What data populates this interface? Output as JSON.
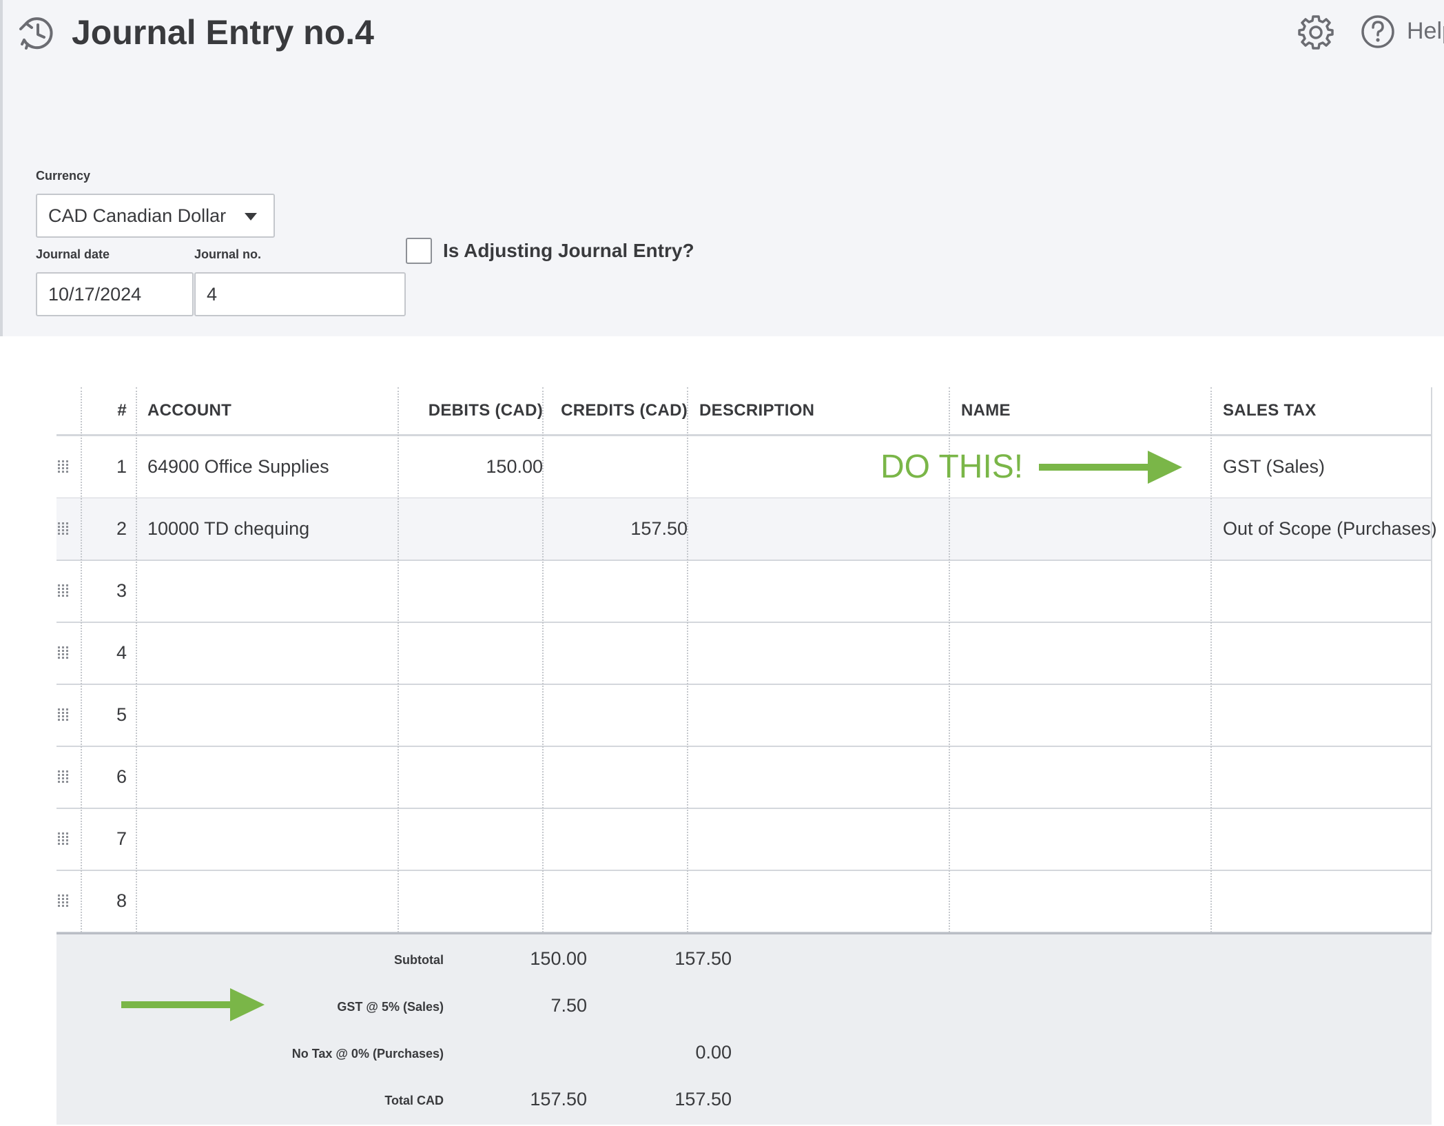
{
  "header": {
    "title": "Journal Entry no.4",
    "help_label": "Help"
  },
  "form": {
    "currency_label": "Currency",
    "currency_value": "CAD Canadian Dollar",
    "journal_date_label": "Journal date",
    "journal_date_value": "10/17/2024",
    "journal_no_label": "Journal no.",
    "journal_no_value": "4",
    "adjusting_label": "Is Adjusting Journal Entry?",
    "adjusting_checked": false
  },
  "table": {
    "columns": [
      "#",
      "ACCOUNT",
      "DEBITS (CAD)",
      "CREDITS (CAD)",
      "DESCRIPTION",
      "NAME",
      "SALES TAX"
    ],
    "rows": [
      {
        "num": "1",
        "account": "64900 Office Supplies",
        "debit": "150.00",
        "credit": "",
        "description": "",
        "name": "",
        "sales_tax": "GST (Sales)"
      },
      {
        "num": "2",
        "account": "10000 TD chequing",
        "debit": "",
        "credit": "157.50",
        "description": "",
        "name": "",
        "sales_tax": "Out of Scope (Purchases)"
      },
      {
        "num": "3",
        "account": "",
        "debit": "",
        "credit": "",
        "description": "",
        "name": "",
        "sales_tax": ""
      },
      {
        "num": "4",
        "account": "",
        "debit": "",
        "credit": "",
        "description": "",
        "name": "",
        "sales_tax": ""
      },
      {
        "num": "5",
        "account": "",
        "debit": "",
        "credit": "",
        "description": "",
        "name": "",
        "sales_tax": ""
      },
      {
        "num": "6",
        "account": "",
        "debit": "",
        "credit": "",
        "description": "",
        "name": "",
        "sales_tax": ""
      },
      {
        "num": "7",
        "account": "",
        "debit": "",
        "credit": "",
        "description": "",
        "name": "",
        "sales_tax": ""
      },
      {
        "num": "8",
        "account": "",
        "debit": "",
        "credit": "",
        "description": "",
        "name": "",
        "sales_tax": ""
      }
    ]
  },
  "totals": [
    {
      "label": "Subtotal",
      "debit": "150.00",
      "credit": "157.50"
    },
    {
      "label": "GST @ 5% (Sales)",
      "debit": "7.50",
      "credit": ""
    },
    {
      "label": "No Tax @ 0% (Purchases)",
      "debit": "",
      "credit": "0.00"
    },
    {
      "label": "Total CAD",
      "debit": "157.50",
      "credit": "157.50"
    }
  ],
  "annotations": {
    "do_this": "DO THIS!",
    "accent_color": "#7ab648"
  },
  "icons": [
    "recurring-clock-icon",
    "gear-icon",
    "help-circle-icon",
    "drag-handle-icon",
    "dropdown-caret-icon"
  ]
}
